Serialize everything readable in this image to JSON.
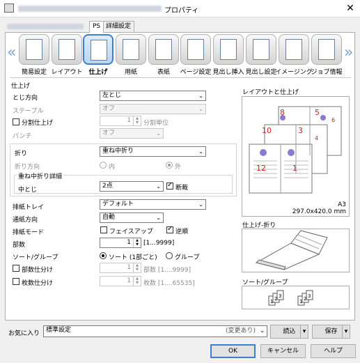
{
  "window": {
    "title": "プロパティ",
    "close": "✕"
  },
  "tabs": [
    {
      "label": "PS"
    },
    {
      "label": "詳細設定"
    }
  ],
  "nav": {
    "prev": "«",
    "next": "»"
  },
  "toolbar": [
    {
      "label": "簡易設定"
    },
    {
      "label": "レイアウト"
    },
    {
      "label": "仕上げ"
    },
    {
      "label": "用紙"
    },
    {
      "label": "表紙"
    },
    {
      "label": "ページ設定"
    },
    {
      "label": "見出し挿入"
    },
    {
      "label": "見出し設定"
    },
    {
      "label": "イメージング"
    },
    {
      "label": "ジョブ情報"
    }
  ],
  "finishing": {
    "header": "仕上げ",
    "binding_label": "とじ方向",
    "binding_value": "左とじ",
    "staple_label": "ステープル",
    "staple_value": "オフ",
    "split_label": "分割仕上げ",
    "split_value": "1",
    "split_unit": "分割単位",
    "punch_label": "パンチ",
    "punch_value": "オフ",
    "fold_label": "折り",
    "fold_value": "重ね中折り",
    "fold_dir_label": "折り方向",
    "fold_dir_in": "内",
    "fold_dir_out": "外",
    "detail_header": "重ね中折り詳細",
    "nakatoji_label": "中とじ",
    "nakatoji_value": "2点",
    "cut_label": "断裁",
    "tray_label": "排紙トレイ",
    "tray_value": "デフォルト",
    "feed_label": "通紙方向",
    "feed_value": "自動",
    "output_mode_label": "排紙モード",
    "faceup_label": "フェイスアップ",
    "reverse_label": "逆順",
    "copies_label": "部数",
    "copies_value": "1",
    "copies_range": "[1...9999]",
    "sort_label": "ソート/グループ",
    "sort_option": "ソート (1部ごと)",
    "group_option": "グループ",
    "set_split_label": "部数仕分け",
    "set_split_value": "1",
    "set_split_unit": "部数 [1....9999]",
    "sheet_split_label": "枚数仕分け",
    "sheet_split_value": "1",
    "sheet_split_unit": "枚数 [1....65535]"
  },
  "preview": {
    "layout_title": "レイアウトと仕上げ",
    "page_numbers": [
      "8",
      "5",
      "6",
      "10",
      "3",
      "4",
      "12",
      "1"
    ],
    "paper_size": "A3",
    "paper_dims": "297.0x420.0 mm",
    "fold_title": "仕上げ-折り",
    "sort_title": "ソート/グループ",
    "sort_pages": [
      "1",
      "2",
      "3",
      "1",
      "2",
      "3"
    ]
  },
  "favorites": {
    "label": "お気に入り",
    "value": "標準設定",
    "changed": "(変更あり)",
    "load": "読込",
    "save": "保存"
  },
  "buttons": {
    "ok": "OK",
    "cancel": "キャンセル",
    "help": "ヘルプ"
  },
  "colors": {
    "accent": "#3c7fc8",
    "page_number": "#cc2222"
  }
}
